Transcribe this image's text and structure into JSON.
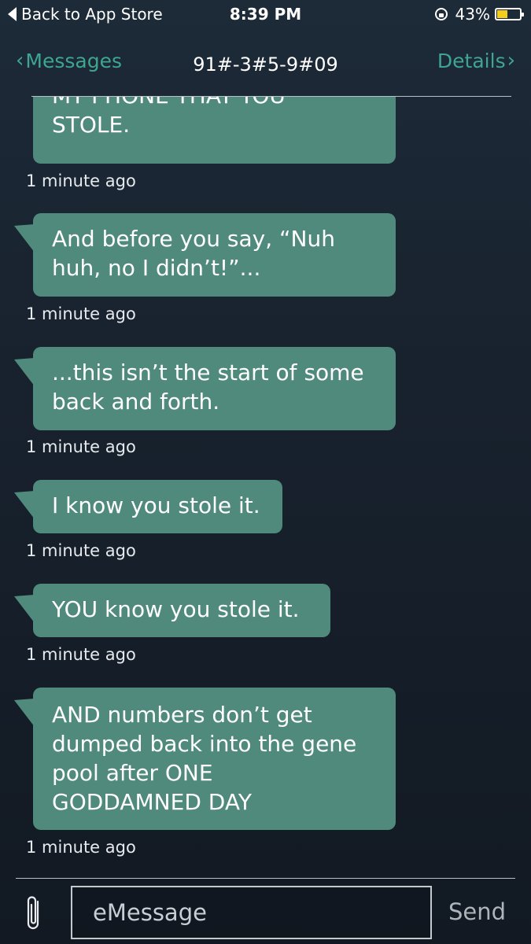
{
  "status_bar": {
    "back_label": "Back to App Store",
    "time": "8:39 PM",
    "battery": "43%",
    "battery_level": 0.43,
    "icons": [
      "back-triangle-icon",
      "rotation-lock-icon",
      "battery-icon"
    ]
  },
  "nav": {
    "back_label": "Messages",
    "title": "91#-3#5-9#09",
    "details_label": "Details",
    "accent_color": "#3ea590"
  },
  "messages": [
    {
      "text": "MY PHONE THAT YOU STOLE.",
      "lines": [
        "MY PHONE THAT YOU",
        "STOLE."
      ],
      "timestamp": "1 minute ago"
    },
    {
      "text": "And before you say, “Nuh huh, no I didn’t!”...",
      "lines": [
        "And before you say, “Nuh",
        "huh, no I didn’t!”..."
      ],
      "timestamp": "1 minute ago"
    },
    {
      "text": "...this isn’t the start of some back and forth.",
      "lines": [
        "...this isn’t the start of some",
        "back and forth."
      ],
      "timestamp": "1 minute ago"
    },
    {
      "text": "I know you stole it.",
      "lines": [
        "I know you stole it."
      ],
      "timestamp": "1 minute ago"
    },
    {
      "text": "YOU know you stole it.",
      "lines": [
        "YOU know you stole it."
      ],
      "timestamp": "1 minute ago"
    },
    {
      "text": "AND numbers don’t get dumped back into the gene pool after ONE GODDAMNED DAY",
      "lines": [
        "AND numbers don’t get",
        "dumped back into the gene",
        "pool after ONE",
        "GODDAMNED DAY"
      ],
      "timestamp": "1 minute ago"
    }
  ],
  "composer": {
    "placeholder": "eMessage",
    "send_label": "Send",
    "attach_icon": "paperclip-icon"
  },
  "colors": {
    "bubble": "#4f8a7c",
    "background": "#18222e",
    "battery_fill": "#f6cc1d"
  }
}
